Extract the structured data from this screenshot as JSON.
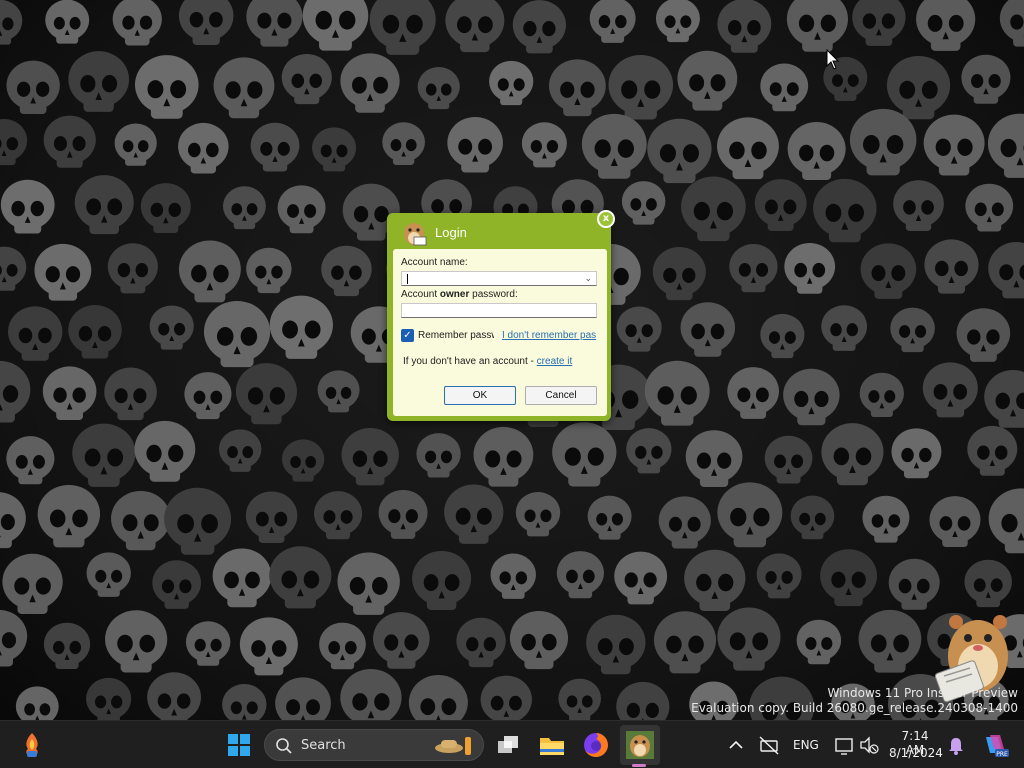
{
  "dialog": {
    "title": "Login",
    "close_label": "x",
    "account_name_label": "Account name:",
    "password_label_prefix": "Account ",
    "password_label_bold": "owner",
    "password_label_suffix": " password:",
    "account_name_value": "",
    "password_value": "",
    "remember_checked": true,
    "remember_label": "Remember passw",
    "forgot_link": "I don't remember pas",
    "no_account_prefix": "If you don't have an account - ",
    "create_link": "create it",
    "ok_label": "OK",
    "cancel_label": "Cancel"
  },
  "desktop": {
    "watermark_line1": "Windows 11 Pro Insider Preview",
    "watermark_line2": "Evaluation copy. Build 26080.ge_release.240308-1400"
  },
  "taskbar": {
    "search_label": "Search",
    "language": "ENG",
    "time": "7:14 AM",
    "date": "8/1/2024",
    "apps": [
      "widgets-icon",
      "start-icon",
      "task-view-icon",
      "file-explorer-icon",
      "firefox-icon",
      "hamster-app-icon"
    ]
  },
  "colors": {
    "dialog_frame": "#8fb428",
    "dialog_body": "#fafadc",
    "link": "#2a6fb0",
    "taskbar": "#1f1f1f"
  }
}
